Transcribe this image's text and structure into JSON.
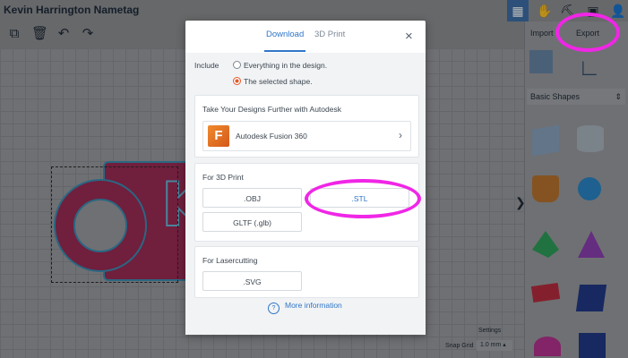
{
  "app": {
    "title": "Kevin Harrington Nametag",
    "right_tabs": {
      "import": "Import",
      "export": "Export"
    },
    "shape_category": "Basic Shapes",
    "settings": "Settings",
    "snap_grid_label": "Snap Grid",
    "snap_grid_value": "1.0 mm",
    "canvas_text": "Ke"
  },
  "modal": {
    "tabs": [
      {
        "label": "Download"
      },
      {
        "label": "3D Print"
      }
    ],
    "close_glyph": "×",
    "include": {
      "label": "Include",
      "options": [
        {
          "label": "Everything in the design.",
          "selected": false
        },
        {
          "label": "The selected shape.",
          "selected": true
        }
      ]
    },
    "autodesk": {
      "title": "Take Your Designs Further with Autodesk",
      "product": "Autodesk Fusion 360",
      "logo_letter": "F"
    },
    "print3d": {
      "title": "For 3D Print",
      "formats": [
        ".OBJ",
        ".STL",
        "GLTF (.glb)"
      ]
    },
    "laser": {
      "title": "For Lasercutting",
      "formats": [
        ".SVG"
      ]
    },
    "more_info": "More information"
  },
  "colors": {
    "accent": "#2f76c7",
    "highlight": "#f026e6",
    "radio_on": "#e2592b"
  }
}
